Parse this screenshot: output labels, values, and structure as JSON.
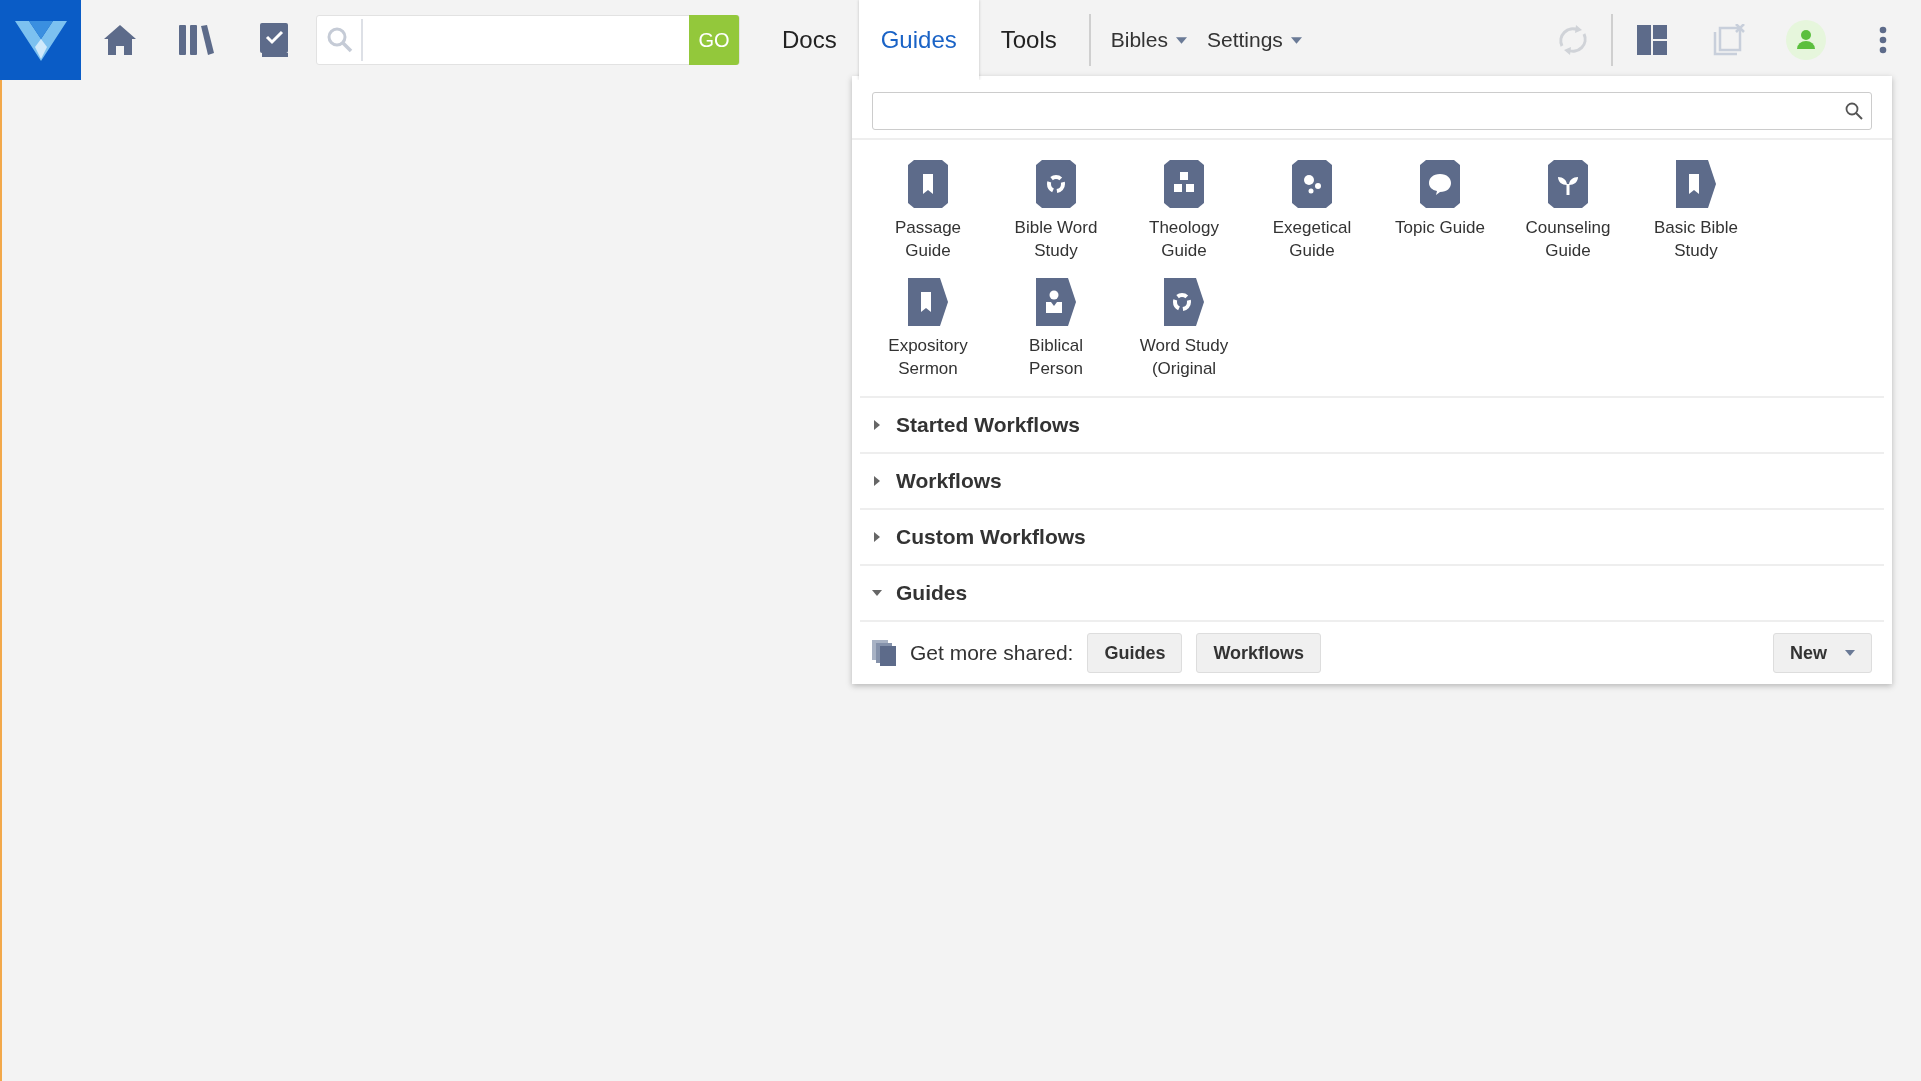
{
  "toolbar": {
    "search": {
      "button": "GO"
    },
    "tabs": [
      {
        "label": "Docs",
        "selected": false
      },
      {
        "label": "Guides",
        "selected": true
      },
      {
        "label": "Tools",
        "selected": false
      }
    ],
    "menus": [
      {
        "label": "Bibles"
      },
      {
        "label": "Settings"
      }
    ]
  },
  "guides_panel": {
    "tiles": [
      {
        "label": "Passage Guide",
        "kind": "shield"
      },
      {
        "label": "Bible Word Study",
        "kind": "shield"
      },
      {
        "label": "Theology Guide",
        "kind": "shield"
      },
      {
        "label": "Exegetical Guide",
        "kind": "shield"
      },
      {
        "label": "Topic Guide",
        "kind": "shield"
      },
      {
        "label": "Counseling Guide",
        "kind": "shield"
      },
      {
        "label": "Basic Bible Study",
        "kind": "tag"
      },
      {
        "label": "Expository Sermon",
        "kind": "tag"
      },
      {
        "label": "Biblical Person",
        "kind": "tag"
      },
      {
        "label": "Word Study (Original",
        "kind": "tag"
      }
    ],
    "sections": [
      {
        "label": "Started Workflows",
        "expanded": false
      },
      {
        "label": "Workflows",
        "expanded": false
      },
      {
        "label": "Custom Workflows",
        "expanded": false
      },
      {
        "label": "Guides",
        "expanded": true
      }
    ],
    "footer": {
      "label": "Get more shared:",
      "buttons": [
        "Guides",
        "Workflows"
      ],
      "new_button": "New"
    }
  }
}
